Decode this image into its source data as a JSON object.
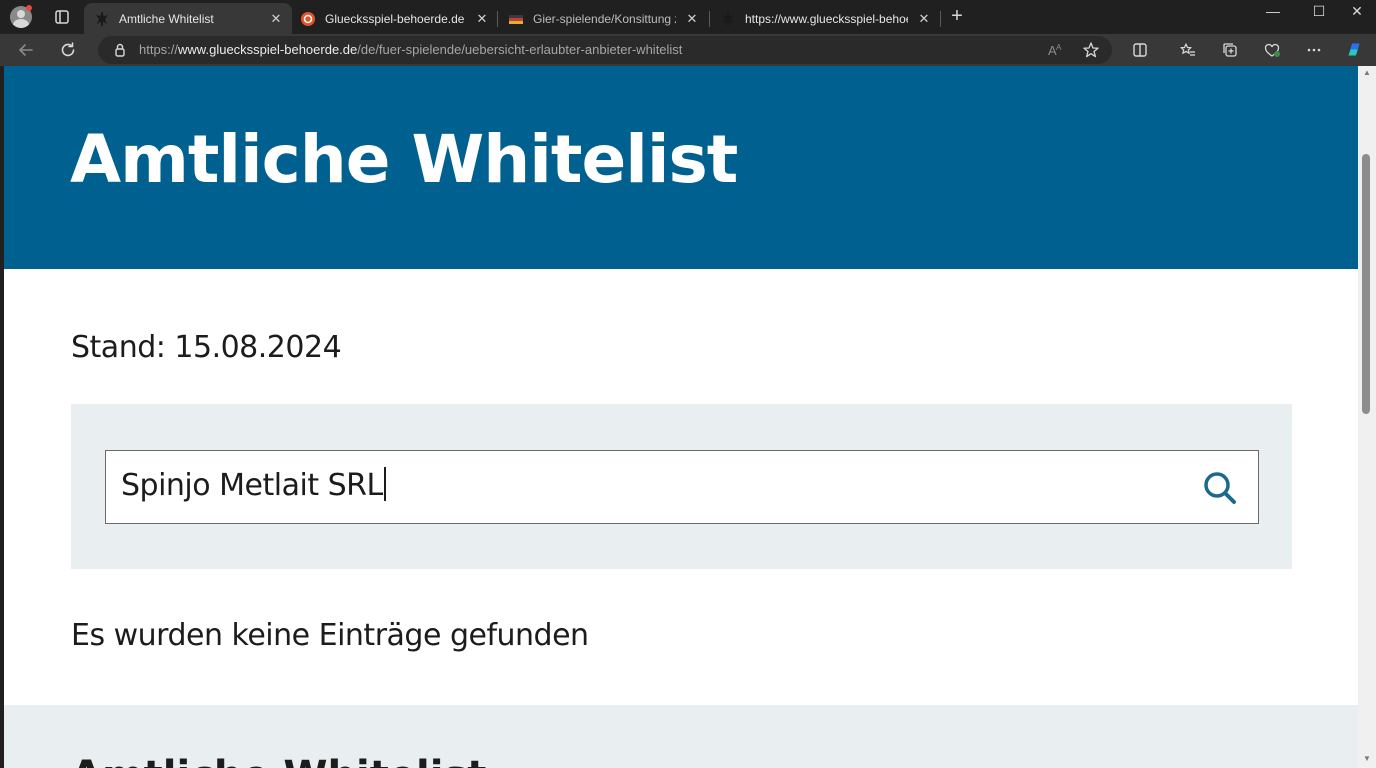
{
  "browser": {
    "tabs": [
      {
        "title": "Amtliche Whitelist",
        "active": true,
        "favicon": "ggl-eagle-icon"
      },
      {
        "title": "Gluecksspiel-behoerde.de",
        "active": false,
        "favicon": "orange-circle-icon"
      },
      {
        "title": "Gier-spielende/Konsittung zers",
        "active": false,
        "favicon": "flag-icon"
      },
      {
        "title": "https://www.gluecksspiel-behoerde",
        "active": false,
        "favicon": "ggl-eagle-icon"
      }
    ],
    "close_glyph": "✕",
    "new_tab_glyph": "+",
    "window_controls": {
      "minimize": "—",
      "maximize": "☐",
      "close": "✕"
    },
    "address": {
      "scheme": "https://",
      "host": "www.gluecksspiel-behoerde.de",
      "path": "/de/fuer-spielende/uebersicht-erlaubter-anbieter-whitelist"
    },
    "colors": {
      "frame": "#202020",
      "toolbar": "#383838",
      "copilot": "#1fa7e6"
    }
  },
  "page": {
    "hero_title": "Amtliche Whitelist",
    "stand": "Stand: 15.08.2024",
    "search": {
      "value": "Spinjo Metlait SRL"
    },
    "result_message": "Es wurden keine Einträge gefunden",
    "footer_heading": "Amtliche Whitelist",
    "colors": {
      "hero": "#00608f",
      "search_panel": "#e9eef1",
      "search_icon": "#1a6a8f"
    }
  }
}
